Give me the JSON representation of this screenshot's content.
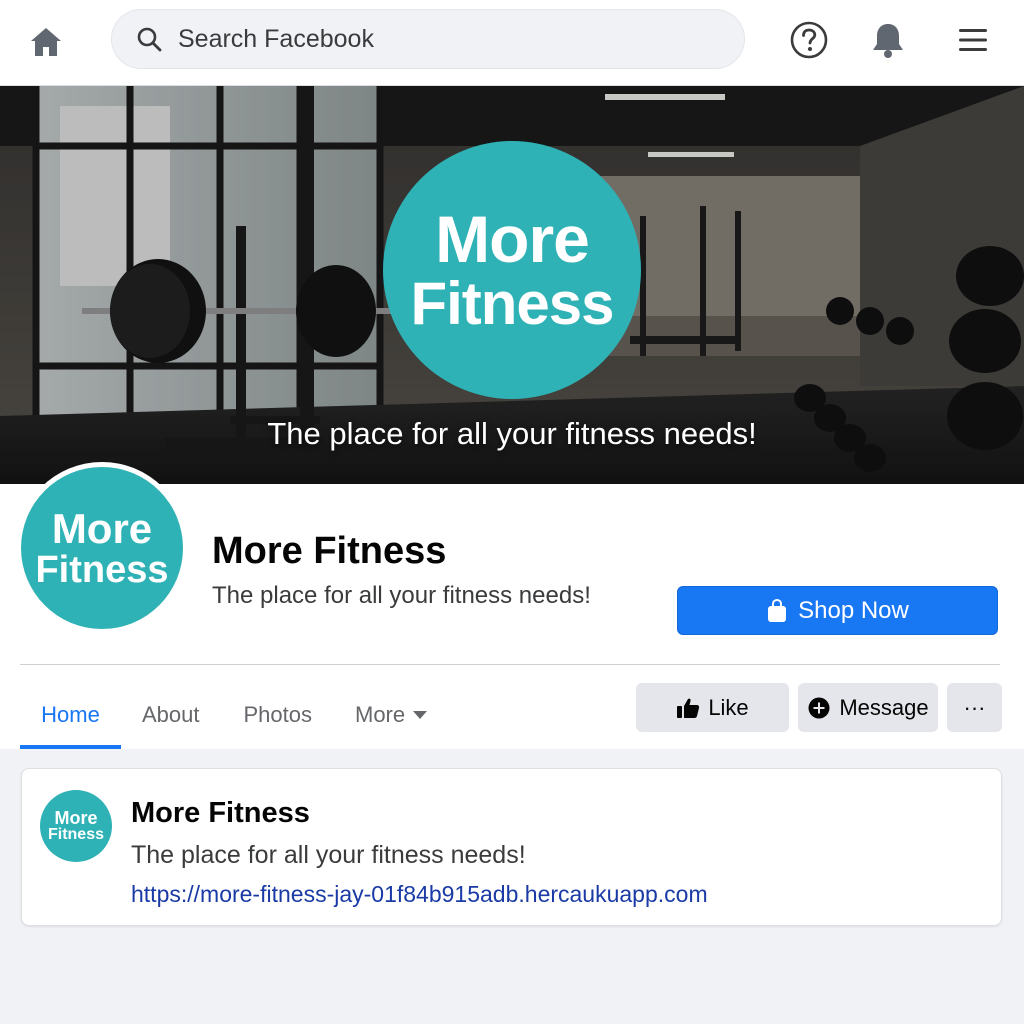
{
  "topbar": {
    "search_placeholder": "Search Facebook",
    "icons": [
      "home-icon",
      "search-icon",
      "help-icon",
      "bell-icon",
      "menu-icon"
    ]
  },
  "cover": {
    "logo_line1": "More",
    "logo_line2": "Fitness",
    "tagline": "The place for all your fitness needs!"
  },
  "profile": {
    "avatar_line1": "More",
    "avatar_line2": "Fitness",
    "name": "More Fitness",
    "tagline": "The place for all your fitness needs!",
    "cta_label": "Shop Now"
  },
  "tabs": [
    {
      "label": "Home",
      "active": true
    },
    {
      "label": "About"
    },
    {
      "label": "Photos"
    },
    {
      "label": "More"
    }
  ],
  "actions": {
    "like_label": "Like",
    "message_label": "Message",
    "more_label": "···"
  },
  "post": {
    "avatar_line1": "More",
    "avatar_line2": "Fitness",
    "title": "More Fitness",
    "text": "The place for all your fitness needs!",
    "link": "https://more-fitness-jay-01f84b915adb.hercaukuapp.com"
  },
  "colors": {
    "brand_teal": "#2fb2b6",
    "facebook_blue": "#1877f2",
    "link_blue": "#1a3aa5"
  }
}
